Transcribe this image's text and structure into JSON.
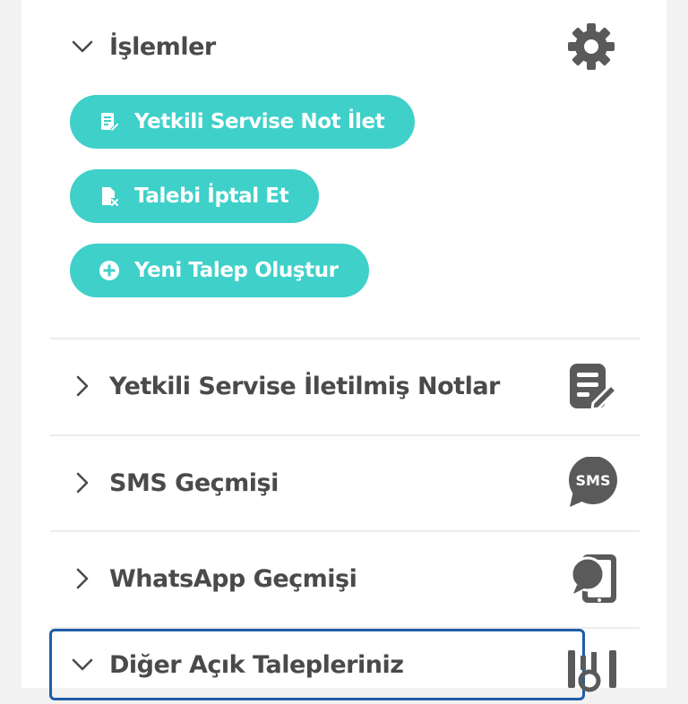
{
  "section": {
    "title": "İşlemler",
    "icon": "gear-icon",
    "expanded": true
  },
  "actions": [
    {
      "label": "Yetkili Servise Not İlet",
      "icon": "note-edit-icon"
    },
    {
      "label": "Talebi İptal Et",
      "icon": "file-cancel-icon"
    },
    {
      "label": "Yeni Talep Oluştur",
      "icon": "plus-circle-icon"
    }
  ],
  "rows": [
    {
      "label": "Yetkili Servise İletilmiş Notlar",
      "icon": "notes-icon",
      "expanded": false
    },
    {
      "label": "SMS Geçmişi",
      "icon": "sms-bubble-icon",
      "icon_text": "SMS",
      "expanded": false
    },
    {
      "label": "WhatsApp Geçmişi",
      "icon": "phone-chat-icon",
      "expanded": false
    },
    {
      "label": "Diğer Açık Talepleriniz",
      "icon": "search-list-icon",
      "expanded": true
    }
  ],
  "colors": {
    "accent": "#3fd0c9",
    "text": "#4a4a4a",
    "icon": "#5a5a5a",
    "focus": "#1f5ea8"
  }
}
